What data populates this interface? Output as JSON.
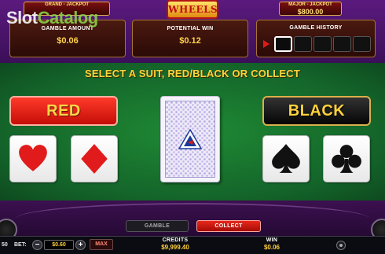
{
  "watermark": {
    "part1": "Slot",
    "part2": "Catalog"
  },
  "logo": {
    "text": "WHEELS"
  },
  "jackpots": {
    "grand": {
      "label": "GRAND - JACKPOT",
      "value": ""
    },
    "major": {
      "label": "MAJOR - JACKPOT",
      "value": "$800.00"
    }
  },
  "panels": {
    "gamble_amount": {
      "label": "GAMBLE AMOUNT",
      "value": "$0.06"
    },
    "potential_win": {
      "label": "POTENTIAL WIN",
      "value": "$0.12"
    },
    "gamble_history": {
      "label": "GAMBLE HISTORY"
    }
  },
  "instruction": "SELECT A SUIT, RED/BLACK OR COLLECT",
  "choices": {
    "red": "RED",
    "black": "BLACK"
  },
  "suits": [
    "hearts",
    "diamonds",
    "spades",
    "clubs"
  ],
  "colors": {
    "red": "#e11b1b",
    "black": "#111111",
    "gold": "#ffd23a",
    "felt": "#1b7a30"
  },
  "tabs": {
    "gamble": "GAMBLE",
    "collect": "COLLECT"
  },
  "footer": {
    "lines": "50",
    "bet_label": "BET:",
    "bet_value": "$0.60",
    "minus": "−",
    "plus": "+",
    "max": "MAX",
    "credits_label": "CREDITS",
    "credits_value": "$9,999.40",
    "win_label": "WIN",
    "win_value": "$0.06"
  }
}
